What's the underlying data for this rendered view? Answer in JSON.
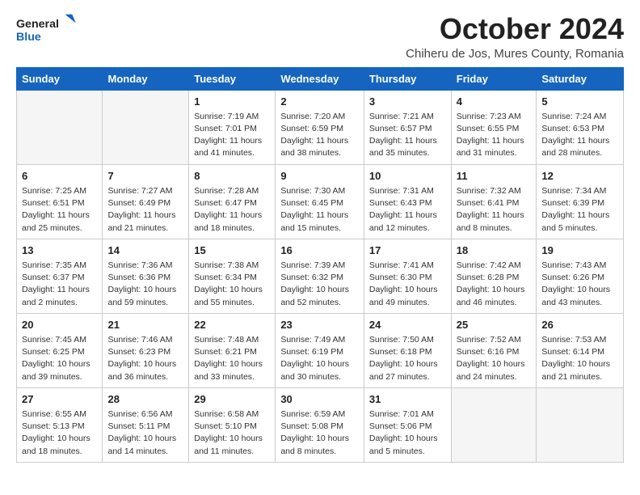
{
  "header": {
    "logo_general": "General",
    "logo_blue": "Blue",
    "month_title": "October 2024",
    "location": "Chiheru de Jos, Mures County, Romania"
  },
  "days_of_week": [
    "Sunday",
    "Monday",
    "Tuesday",
    "Wednesday",
    "Thursday",
    "Friday",
    "Saturday"
  ],
  "weeks": [
    [
      {
        "day": "",
        "empty": true
      },
      {
        "day": "",
        "empty": true
      },
      {
        "day": "1",
        "sunrise": "7:19 AM",
        "sunset": "7:01 PM",
        "daylight": "11 hours and 41 minutes."
      },
      {
        "day": "2",
        "sunrise": "7:20 AM",
        "sunset": "6:59 PM",
        "daylight": "11 hours and 38 minutes."
      },
      {
        "day": "3",
        "sunrise": "7:21 AM",
        "sunset": "6:57 PM",
        "daylight": "11 hours and 35 minutes."
      },
      {
        "day": "4",
        "sunrise": "7:23 AM",
        "sunset": "6:55 PM",
        "daylight": "11 hours and 31 minutes."
      },
      {
        "day": "5",
        "sunrise": "7:24 AM",
        "sunset": "6:53 PM",
        "daylight": "11 hours and 28 minutes."
      }
    ],
    [
      {
        "day": "6",
        "sunrise": "7:25 AM",
        "sunset": "6:51 PM",
        "daylight": "11 hours and 25 minutes."
      },
      {
        "day": "7",
        "sunrise": "7:27 AM",
        "sunset": "6:49 PM",
        "daylight": "11 hours and 21 minutes."
      },
      {
        "day": "8",
        "sunrise": "7:28 AM",
        "sunset": "6:47 PM",
        "daylight": "11 hours and 18 minutes."
      },
      {
        "day": "9",
        "sunrise": "7:30 AM",
        "sunset": "6:45 PM",
        "daylight": "11 hours and 15 minutes."
      },
      {
        "day": "10",
        "sunrise": "7:31 AM",
        "sunset": "6:43 PM",
        "daylight": "11 hours and 12 minutes."
      },
      {
        "day": "11",
        "sunrise": "7:32 AM",
        "sunset": "6:41 PM",
        "daylight": "11 hours and 8 minutes."
      },
      {
        "day": "12",
        "sunrise": "7:34 AM",
        "sunset": "6:39 PM",
        "daylight": "11 hours and 5 minutes."
      }
    ],
    [
      {
        "day": "13",
        "sunrise": "7:35 AM",
        "sunset": "6:37 PM",
        "daylight": "11 hours and 2 minutes."
      },
      {
        "day": "14",
        "sunrise": "7:36 AM",
        "sunset": "6:36 PM",
        "daylight": "10 hours and 59 minutes."
      },
      {
        "day": "15",
        "sunrise": "7:38 AM",
        "sunset": "6:34 PM",
        "daylight": "10 hours and 55 minutes."
      },
      {
        "day": "16",
        "sunrise": "7:39 AM",
        "sunset": "6:32 PM",
        "daylight": "10 hours and 52 minutes."
      },
      {
        "day": "17",
        "sunrise": "7:41 AM",
        "sunset": "6:30 PM",
        "daylight": "10 hours and 49 minutes."
      },
      {
        "day": "18",
        "sunrise": "7:42 AM",
        "sunset": "6:28 PM",
        "daylight": "10 hours and 46 minutes."
      },
      {
        "day": "19",
        "sunrise": "7:43 AM",
        "sunset": "6:26 PM",
        "daylight": "10 hours and 43 minutes."
      }
    ],
    [
      {
        "day": "20",
        "sunrise": "7:45 AM",
        "sunset": "6:25 PM",
        "daylight": "10 hours and 39 minutes."
      },
      {
        "day": "21",
        "sunrise": "7:46 AM",
        "sunset": "6:23 PM",
        "daylight": "10 hours and 36 minutes."
      },
      {
        "day": "22",
        "sunrise": "7:48 AM",
        "sunset": "6:21 PM",
        "daylight": "10 hours and 33 minutes."
      },
      {
        "day": "23",
        "sunrise": "7:49 AM",
        "sunset": "6:19 PM",
        "daylight": "10 hours and 30 minutes."
      },
      {
        "day": "24",
        "sunrise": "7:50 AM",
        "sunset": "6:18 PM",
        "daylight": "10 hours and 27 minutes."
      },
      {
        "day": "25",
        "sunrise": "7:52 AM",
        "sunset": "6:16 PM",
        "daylight": "10 hours and 24 minutes."
      },
      {
        "day": "26",
        "sunrise": "7:53 AM",
        "sunset": "6:14 PM",
        "daylight": "10 hours and 21 minutes."
      }
    ],
    [
      {
        "day": "27",
        "sunrise": "6:55 AM",
        "sunset": "5:13 PM",
        "daylight": "10 hours and 18 minutes."
      },
      {
        "day": "28",
        "sunrise": "6:56 AM",
        "sunset": "5:11 PM",
        "daylight": "10 hours and 14 minutes."
      },
      {
        "day": "29",
        "sunrise": "6:58 AM",
        "sunset": "5:10 PM",
        "daylight": "10 hours and 11 minutes."
      },
      {
        "day": "30",
        "sunrise": "6:59 AM",
        "sunset": "5:08 PM",
        "daylight": "10 hours and 8 minutes."
      },
      {
        "day": "31",
        "sunrise": "7:01 AM",
        "sunset": "5:06 PM",
        "daylight": "10 hours and 5 minutes."
      },
      {
        "day": "",
        "empty": true
      },
      {
        "day": "",
        "empty": true
      }
    ]
  ]
}
